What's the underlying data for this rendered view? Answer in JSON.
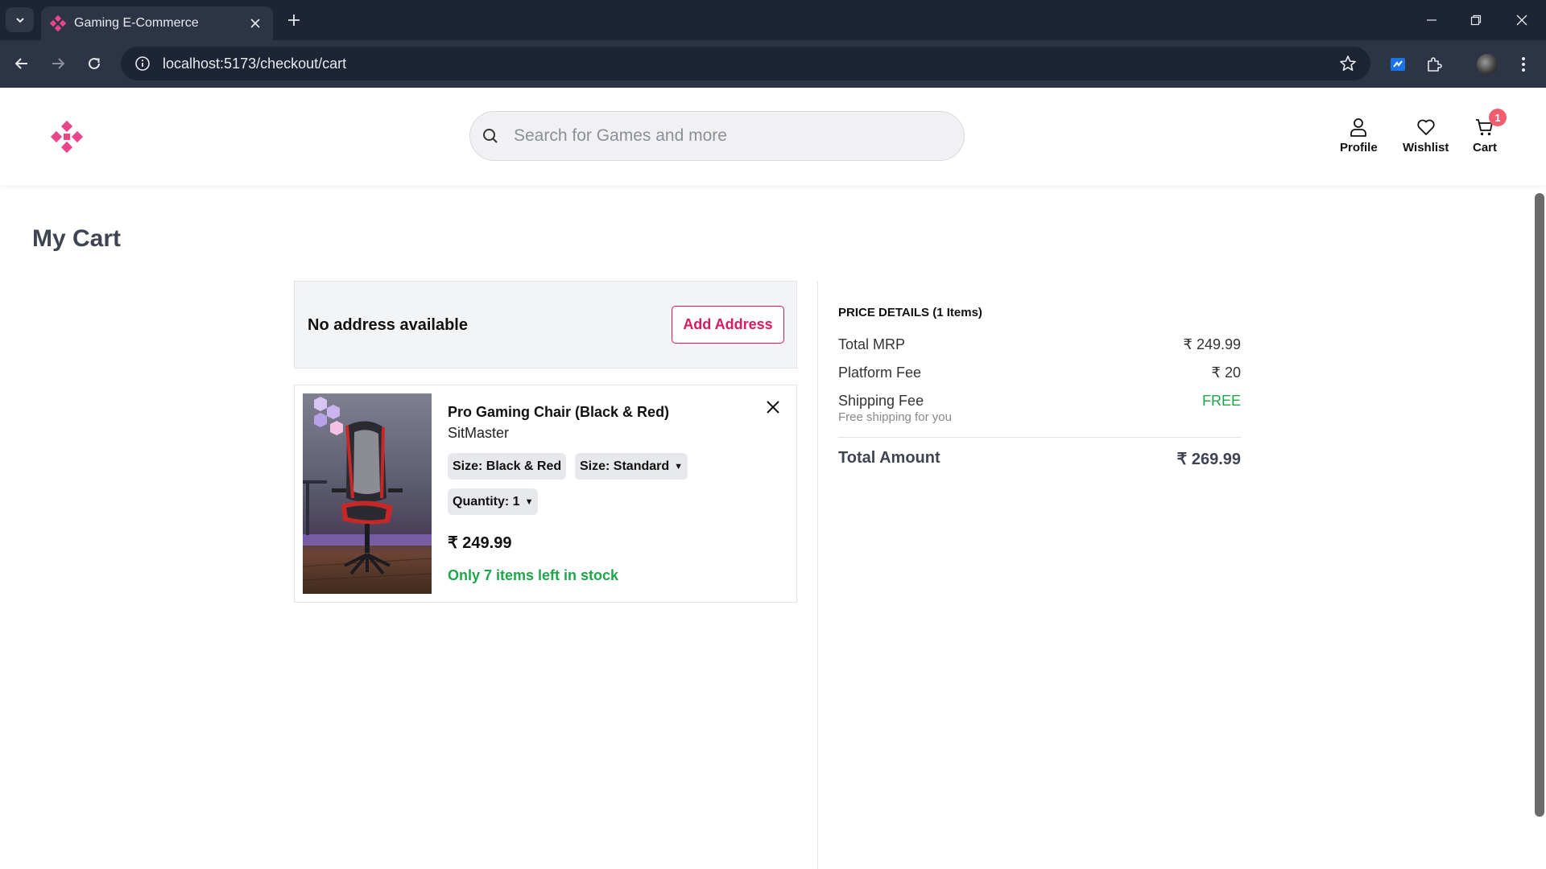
{
  "browser": {
    "tab_title": "Gaming E-Commerce",
    "url": "localhost:5173/checkout/cart"
  },
  "header": {
    "search_placeholder": "Search for Games and more",
    "profile_label": "Profile",
    "wishlist_label": "Wishlist",
    "cart_label": "Cart",
    "cart_count": "1",
    "brand_color": "#e8458b"
  },
  "page": {
    "title": "My Cart"
  },
  "address": {
    "message": "No address available",
    "add_button": "Add Address"
  },
  "cart_item": {
    "name": "Pro Gaming Chair (Black & Red)",
    "brand": "SitMaster",
    "color_chip": "Size: Black & Red",
    "size_chip": "Size: Standard",
    "quantity_chip": "Quantity: 1",
    "price": "₹ 249.99",
    "stock": "Only 7 items left in stock"
  },
  "price_details": {
    "heading": "PRICE DETAILS (1 Items)",
    "rows": [
      {
        "label": "Total MRP",
        "value": "₹ 249.99"
      },
      {
        "label": "Platform Fee",
        "value": "₹ 20"
      },
      {
        "label": "Shipping Fee",
        "value": "FREE"
      }
    ],
    "shipping_note": "Free shipping for you",
    "total_label": "Total Amount",
    "total_value": "₹ 269.99"
  }
}
